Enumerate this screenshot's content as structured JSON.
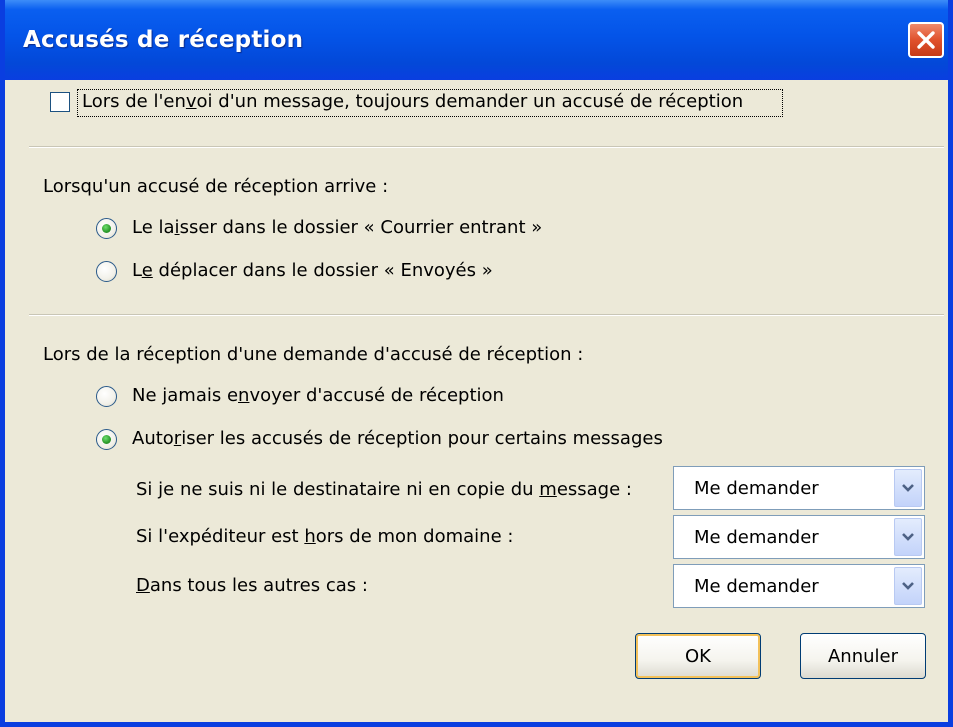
{
  "window": {
    "title": "Accusés de réception"
  },
  "always_request": {
    "label_pre": "Lors de l'en",
    "label_u": "v",
    "label_post": "oi d'un message, toujours demander un accusé de réception",
    "checked": false
  },
  "on_arrival": {
    "heading": "Lorsqu'un accusé de réception arrive :",
    "options": [
      {
        "pre": "Le la",
        "u": "i",
        "post": "sser dans le dossier « Courrier entrant »",
        "checked": true
      },
      {
        "pre": "L",
        "u": "e",
        "post": " déplacer dans le dossier « Envoyés »",
        "checked": false
      }
    ]
  },
  "on_request": {
    "heading": "Lors de la réception d'une demande d'accusé de réception :",
    "options": [
      {
        "pre": "Ne jamais e",
        "u": "n",
        "post": "voyer d'accusé de réception",
        "checked": false
      },
      {
        "pre": "Auto",
        "u": "r",
        "post": "iser les accusés de réception pour certains messages",
        "checked": true
      }
    ],
    "rules": [
      {
        "pre": "Si je ne suis ni le destinataire ni en copie du ",
        "u": "m",
        "post": "essage :",
        "value": "Me demander"
      },
      {
        "pre": "Si l'expéditeur est ",
        "u": "h",
        "post": "ors de mon domaine :",
        "value": "Me demander"
      },
      {
        "pre": "",
        "u": "D",
        "post": "ans tous les autres cas :",
        "value": "Me demander"
      }
    ]
  },
  "buttons": {
    "ok": "OK",
    "cancel": "Annuler"
  },
  "colors": {
    "titlebar": "#0454e8",
    "dialog_bg": "#ece9d8",
    "close": "#e0512c",
    "radio_dot": "#2c9a2c"
  }
}
